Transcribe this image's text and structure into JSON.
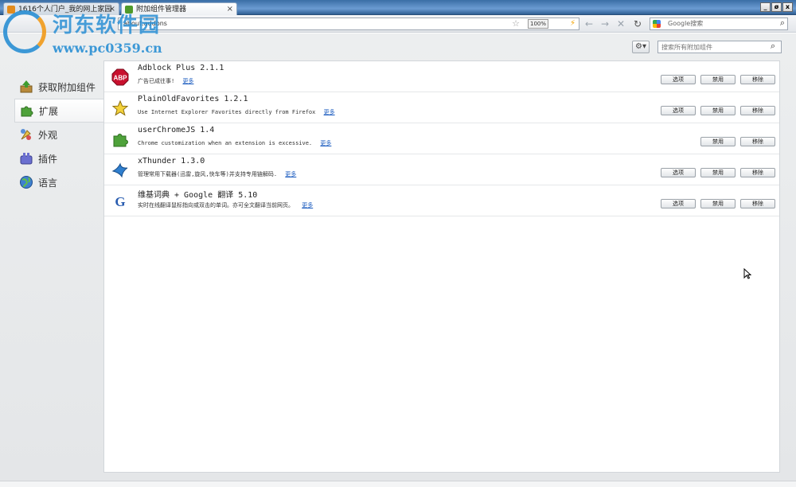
{
  "tabs": [
    {
      "label": "1616个人门户_我的网上家园",
      "active": false,
      "favicon_color": "#e38b1c"
    },
    {
      "label": "附加组件管理器",
      "active": true,
      "favicon_color": "#4e9a2a"
    }
  ],
  "window_controls": [
    "_",
    "ø",
    "x"
  ],
  "url": "about:addons",
  "zoom": "100%",
  "search_engine_placeholder": "Google搜索",
  "watermark": {
    "title": "河东软件园",
    "url": "www.pc0359.cn"
  },
  "addons_toolbar": {
    "search_placeholder": "搜索所有附加组件"
  },
  "categories": [
    {
      "label": "获取附加组件",
      "icon": "get-addons-icon",
      "selected": false
    },
    {
      "label": "扩展",
      "icon": "extensions-icon",
      "selected": true
    },
    {
      "label": "外观",
      "icon": "appearance-icon",
      "selected": false
    },
    {
      "label": "插件",
      "icon": "plugins-icon",
      "selected": false
    },
    {
      "label": "语言",
      "icon": "languages-icon",
      "selected": false
    }
  ],
  "button_labels": {
    "options": "选项",
    "disable": "禁用",
    "remove": "移除",
    "more": "更多"
  },
  "addons": [
    {
      "name": "Adblock Plus 2.1.1",
      "desc": "广告已成往事!",
      "icon": "abp-icon",
      "has_options": true
    },
    {
      "name": "PlainOldFavorites 1.2.1",
      "desc": "Use Internet Explorer Favorites directly from Firefox",
      "icon": "star-icon",
      "has_options": true
    },
    {
      "name": "userChromeJS 1.4",
      "desc": "Chrome customization when an extension is excessive.",
      "icon": "puzzle-icon",
      "has_options": false
    },
    {
      "name": "xThunder 1.3.0",
      "desc": "管理常用下载器(迅雷,旋风,快车等)并支持专用链解码.",
      "icon": "bird-icon",
      "has_options": true
    },
    {
      "name": "维基词典 + Google 翻译 5.10",
      "desc": "实时在线翻译鼠标指向或双击的单词。亦可全文翻译当前网页。",
      "icon": "google-g-icon",
      "has_options": true
    }
  ]
}
